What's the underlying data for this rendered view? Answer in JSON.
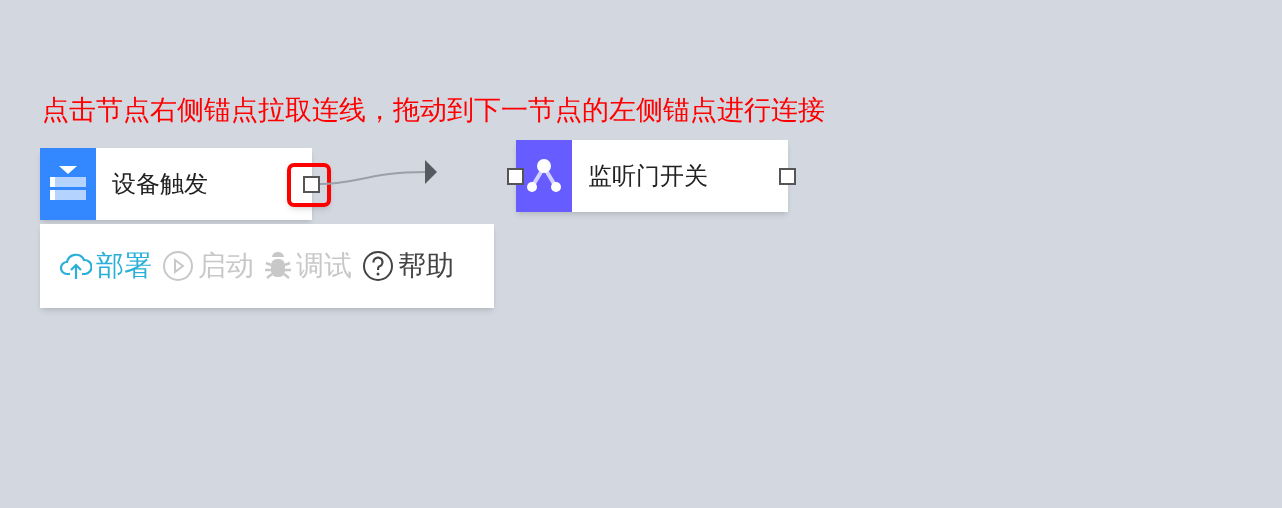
{
  "instruction": "点击节点右侧锚点拉取连线，拖动到下一节点的左侧锚点进行连接",
  "nodes": [
    {
      "label": "设备触发",
      "kind": "trigger",
      "color": "#3388ff",
      "left_anchor": false,
      "right_anchor": true,
      "right_anchor_highlighted": true
    },
    {
      "label": "监听门开关",
      "kind": "listener",
      "color": "#665cff",
      "left_anchor": true,
      "right_anchor": true,
      "right_anchor_highlighted": false
    }
  ],
  "toolbar": [
    {
      "label": "部署",
      "kind": "deploy",
      "primary": true,
      "disabled": false
    },
    {
      "label": "启动",
      "kind": "start",
      "primary": false,
      "disabled": true
    },
    {
      "label": "调试",
      "kind": "debug",
      "primary": false,
      "disabled": true
    },
    {
      "label": "帮助",
      "kind": "help",
      "primary": false,
      "disabled": false
    }
  ]
}
